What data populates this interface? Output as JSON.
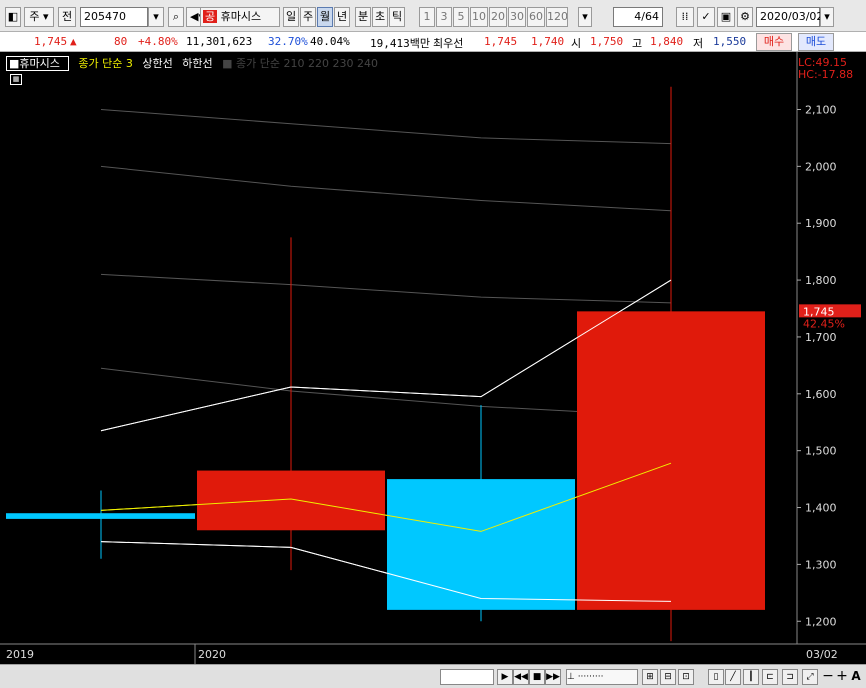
{
  "toolbar": {
    "market": "주",
    "prev_label": "전",
    "code": "205470",
    "badge": "공",
    "stock_name": "휴마시스",
    "periods": [
      "일",
      "주",
      "월",
      "년",
      "분",
      "초",
      "틱"
    ],
    "active_period": "월",
    "intervals": [
      "1",
      "3",
      "5",
      "10",
      "20",
      "30",
      "60",
      "120"
    ],
    "page": "4/64",
    "date": "2020/03/02"
  },
  "quote": {
    "price": "1,745",
    "change": "80",
    "change_pct": "+4.80%",
    "volume": "11,301,623",
    "pct1": "32.70%",
    "pct2": "40.04%",
    "amount": "19,413백만",
    "best_label": "최우선",
    "best_ask": "1,745",
    "best_bid": "1,740",
    "open_label": "시",
    "open": "1,750",
    "high_label": "고",
    "high": "1,840",
    "low_label": "저",
    "low": "1,550",
    "buy": "매수",
    "sell": "매도"
  },
  "legend": {
    "name": "휴마시스",
    "ma": "종가 단순 3",
    "upper": "상한선",
    "lower": "하한선",
    "ma_multi": "종가 단순 210 220 230 240"
  },
  "indicators": {
    "lc": "LC:49.15",
    "hc": "HC:-17.88",
    "price_tag": "1,745",
    "price_pct": "42.45%"
  },
  "chart_data": {
    "type": "candlestick",
    "ylim": [
      1160,
      2180
    ],
    "yticks": [
      1200,
      1300,
      1400,
      1500,
      1600,
      1700,
      1800,
      1900,
      2000,
      2100
    ],
    "x_labels": [
      "2019",
      "2020",
      "03/02"
    ],
    "candles": [
      {
        "open": 1390,
        "close": 1380,
        "high": 1430,
        "low": 1310
      },
      {
        "open": 1360,
        "close": 1465,
        "high": 1875,
        "low": 1290
      },
      {
        "open": 1450,
        "close": 1220,
        "high": 1580,
        "low": 1200
      },
      {
        "open": 1220,
        "close": 1745,
        "high": 2140,
        "low": 1165
      }
    ],
    "series": [
      {
        "name": "종가 단순 3",
        "color": "#f0f000",
        "values": [
          1395,
          1415,
          1358,
          1478
        ]
      },
      {
        "name": "상한선",
        "color": "#ffffff",
        "values": [
          1535,
          1612,
          1595,
          1800
        ]
      },
      {
        "name": "하한선",
        "color": "#ffffff",
        "values": [
          1340,
          1330,
          1240,
          1235
        ]
      },
      {
        "color": "#555555",
        "values": [
          2100,
          2075,
          2050,
          2040
        ]
      },
      {
        "color": "#555555",
        "values": [
          2000,
          1965,
          1940,
          1922
        ]
      },
      {
        "color": "#555555",
        "values": [
          1810,
          1792,
          1770,
          1760
        ]
      },
      {
        "color": "#555555",
        "values": [
          1645,
          1605,
          1578,
          1560
        ]
      }
    ]
  },
  "colors": {
    "up": "#e01a0b",
    "down": "#00c8ff",
    "bg": "#000000"
  }
}
